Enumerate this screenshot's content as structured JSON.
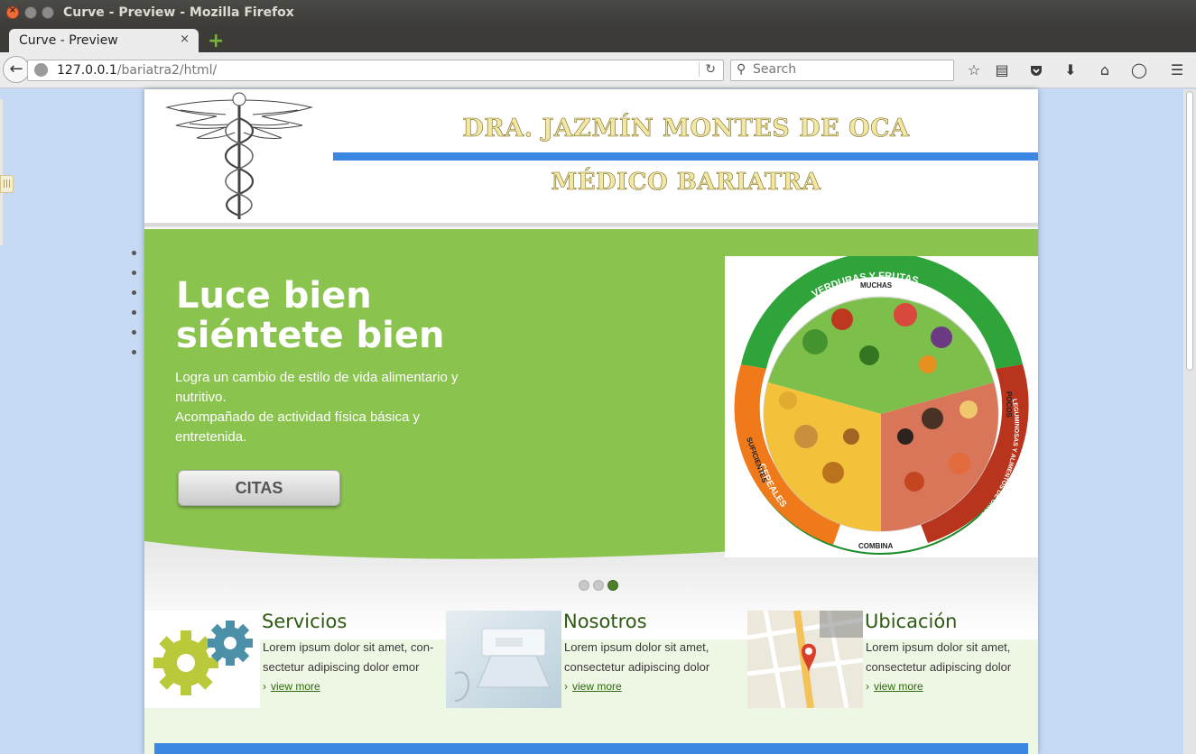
{
  "window": {
    "title": "Curve - Preview - Mozilla Firefox"
  },
  "tab": {
    "label": "Curve - Preview",
    "close": "×",
    "new_tab": "+"
  },
  "nav": {
    "url_host": "127.0.0.1",
    "url_path": "/bariatra2/html/",
    "search_placeholder": "Search"
  },
  "toolbar_icons": [
    "back-icon",
    "reload-icon",
    "search-icon",
    "bookmark-star-icon",
    "reading-list-icon",
    "pocket-icon",
    "download-icon",
    "home-icon",
    "chat-icon",
    "menu-icon"
  ],
  "header": {
    "doctor_name": "DRA. JAZMÍN MONTES DE OCA",
    "specialty": "MÉDICO BARIATRA",
    "accent_color": "#3b87e1"
  },
  "hero": {
    "headline_line1": "Luce bien",
    "headline_line2": "siéntete bien",
    "text_line1": "Logra un cambio de estilo de vida alimentario y nutritivo.",
    "text_line2": "Acompañado de actividad física básica y entretenida.",
    "button_label": "CITAS",
    "background_color": "#8bc34f",
    "slides_count": 3,
    "active_slide": 3,
    "plate": {
      "top_label": "VERDURAS Y FRUTAS",
      "top_sub": "MUCHAS",
      "left_label": "CEREALES",
      "left_sub": "SUFICIENTES",
      "right_label": "LEGUMINOSAS Y ALIMENTOS DE ORIGEN ANIMAL",
      "right_sub": "POCOS",
      "bottom_label": "COMBINA"
    }
  },
  "features": [
    {
      "title": "Servicios",
      "text_line1": "Lorem ipsum dolor sit amet, con-",
      "text_line2": "sectetur adipiscing dolor emor",
      "link": "view more"
    },
    {
      "title": "Nosotros",
      "text_line1": "Lorem ipsum dolor sit amet,",
      "text_line2": "consectetur adipiscing dolor",
      "link": "view more"
    },
    {
      "title": "Ubicación",
      "text_line1": "Lorem ipsum dolor sit amet,",
      "text_line2": "consectetur adipiscing dolor",
      "link": "view more"
    }
  ]
}
